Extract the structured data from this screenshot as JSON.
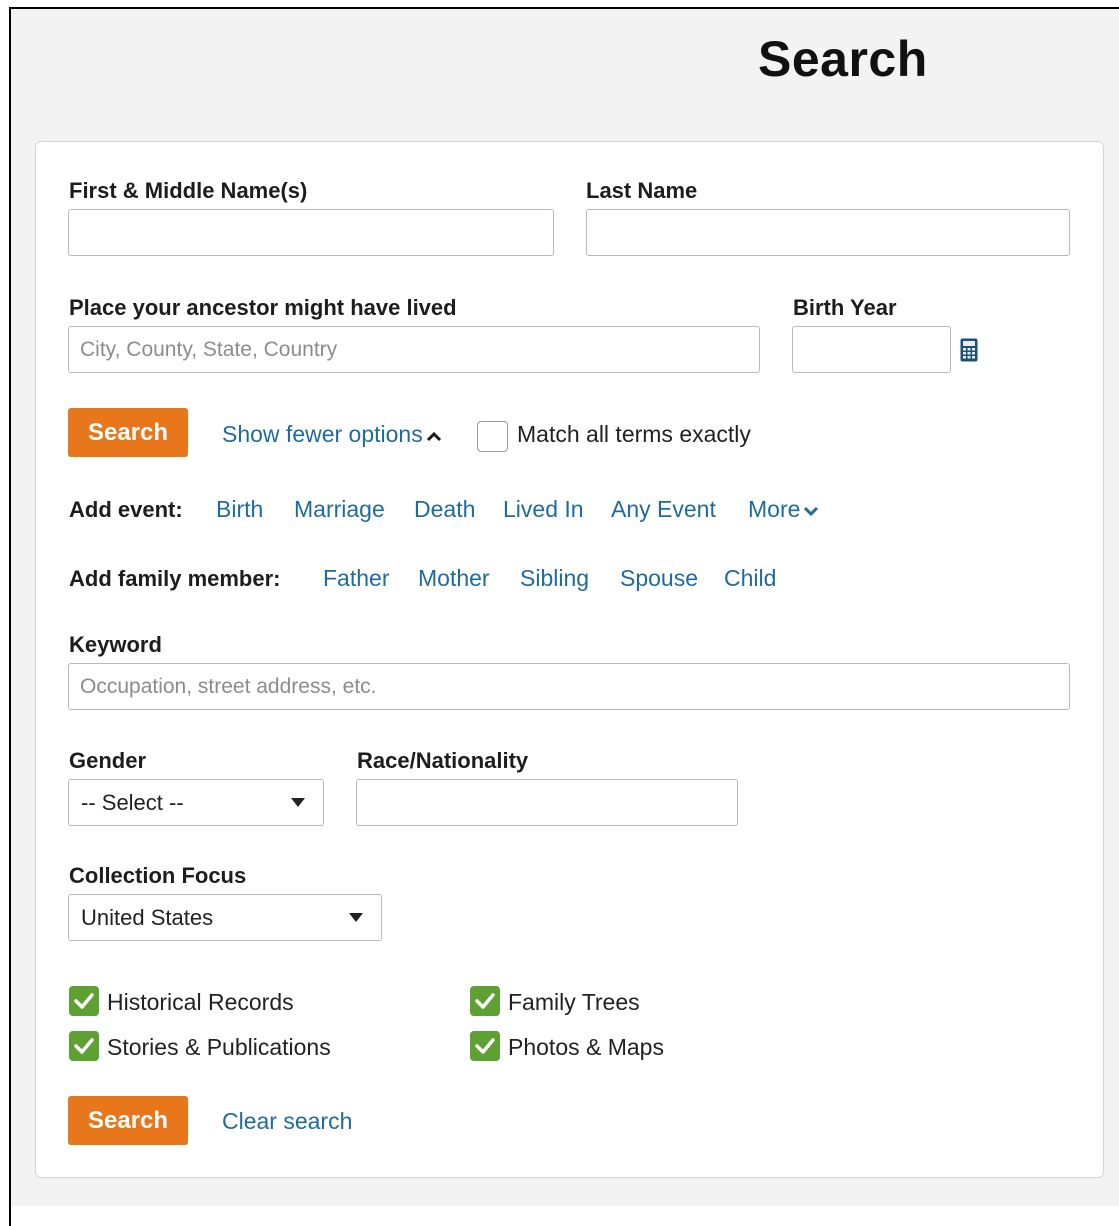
{
  "title": "Search",
  "names": {
    "first_label": "First & Middle Name(s)",
    "first_value": "",
    "last_label": "Last Name",
    "last_value": ""
  },
  "place": {
    "label": "Place your ancestor might have lived",
    "placeholder": "City, County, State, Country",
    "value": ""
  },
  "birth_year": {
    "label": "Birth Year",
    "value": "",
    "icon": "calculator-icon"
  },
  "actions": {
    "search_label": "Search",
    "show_fewer_label": "Show fewer options",
    "match_exact_label": "Match all terms exactly",
    "match_exact_checked": false
  },
  "add_event": {
    "label": "Add event:",
    "items": [
      "Birth",
      "Marriage",
      "Death",
      "Lived In",
      "Any Event"
    ],
    "more_label": "More"
  },
  "add_family": {
    "label": "Add family member:",
    "items": [
      "Father",
      "Mother",
      "Sibling",
      "Spouse",
      "Child"
    ]
  },
  "keyword": {
    "label": "Keyword",
    "placeholder": "Occupation, street address, etc.",
    "value": ""
  },
  "gender": {
    "label": "Gender",
    "selected": "-- Select --"
  },
  "race": {
    "label": "Race/Nationality",
    "value": ""
  },
  "collection": {
    "label": "Collection Focus",
    "selected": "United States"
  },
  "categories": [
    {
      "label": "Historical Records",
      "checked": true
    },
    {
      "label": "Family Trees",
      "checked": true
    },
    {
      "label": "Stories & Publications",
      "checked": true
    },
    {
      "label": "Photos & Maps",
      "checked": true
    }
  ],
  "footer": {
    "search_label": "Search",
    "clear_label": "Clear search"
  },
  "colors": {
    "accent": "#e8761b",
    "link": "#1f6b9d",
    "check": "#5fa032"
  }
}
